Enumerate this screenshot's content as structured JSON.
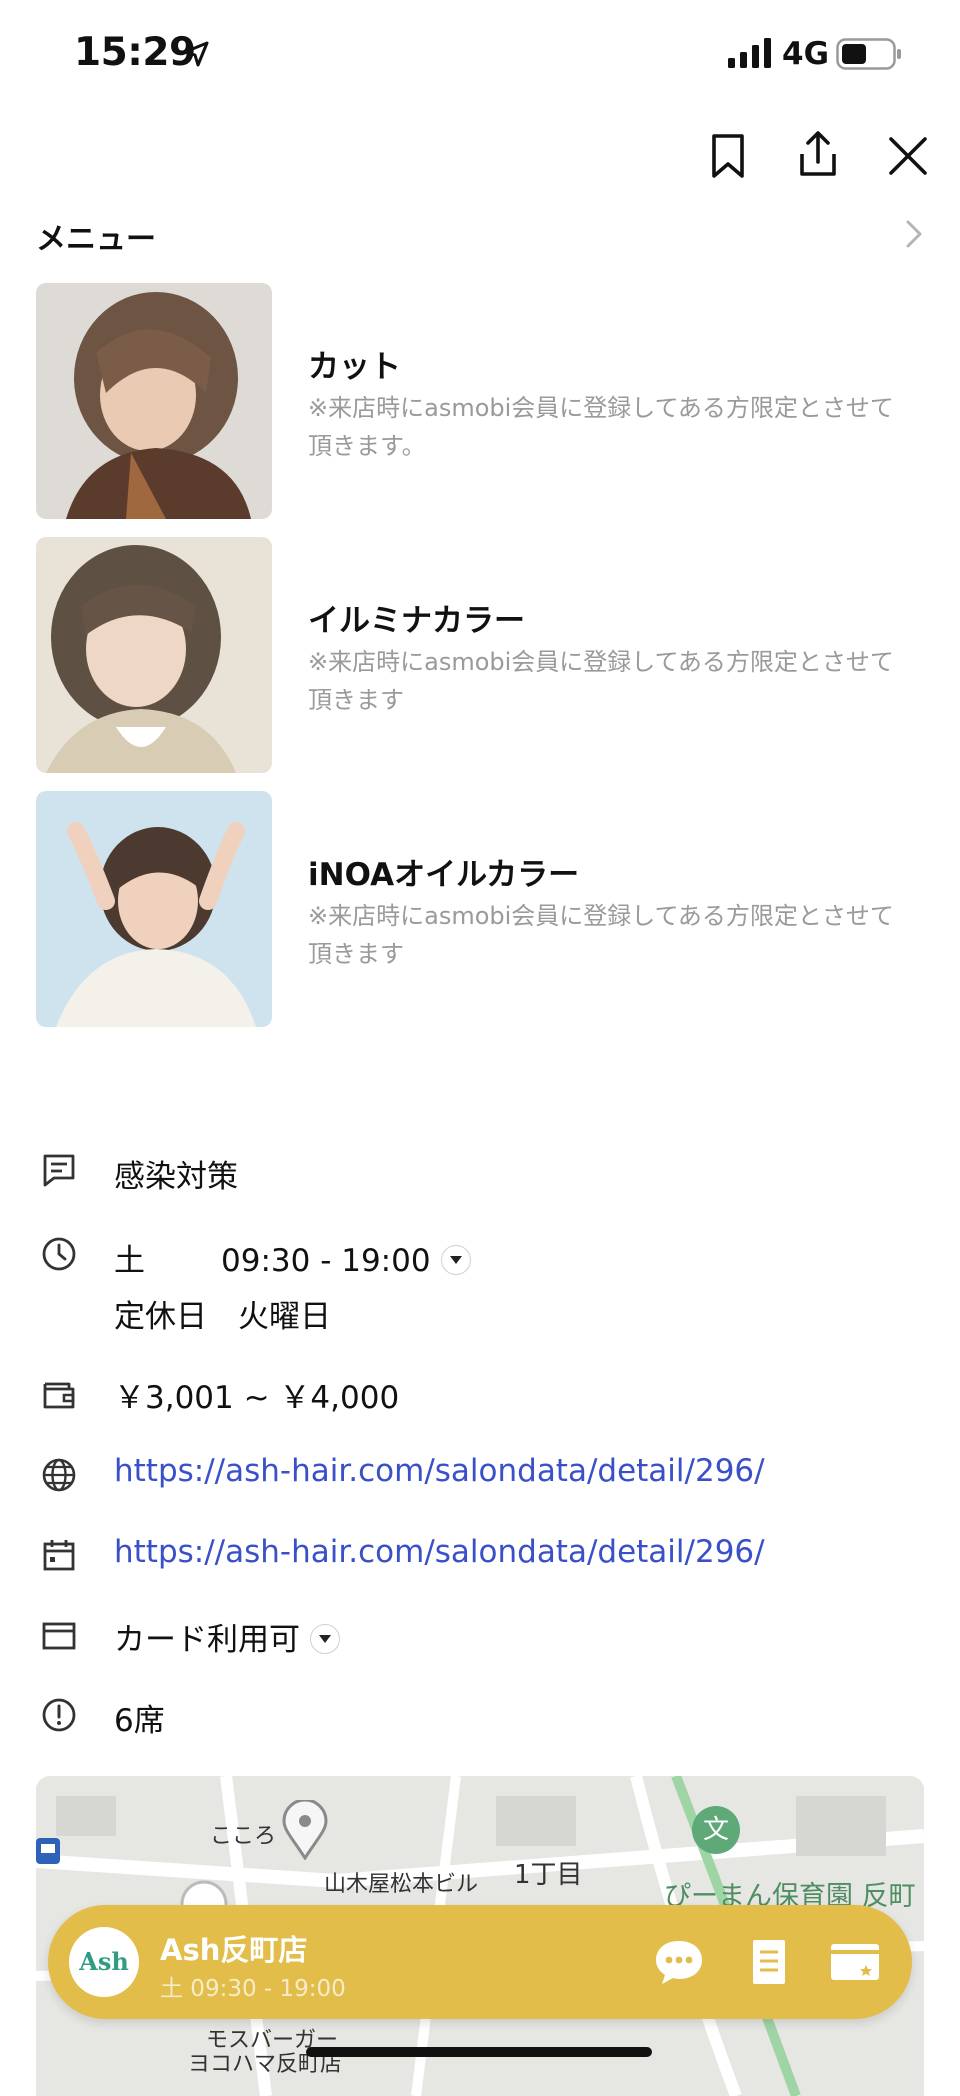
{
  "status_bar": {
    "time": "15:29",
    "network": "4G"
  },
  "menu": {
    "title": "メニュー",
    "items": [
      {
        "name": "カット",
        "description": "※来店時にasmobi会員に登録してある方限定とさせて頂きます。"
      },
      {
        "name": "イルミナカラー",
        "description": "※来店時にasmobi会員に登録してある方限定とさせて頂きます"
      },
      {
        "name": "iNOAオイルカラー",
        "description": "※来店時にasmobi会員に登録してある方限定とさせて頂きます"
      }
    ]
  },
  "info": {
    "infection_control": "感染対策",
    "hours_day": "土",
    "hours_time": "09:30 - 19:00",
    "closed_day": "定休日　火曜日",
    "price_range": "￥3,001 ~ ￥4,000",
    "website_url": "https://ash-hair.com/salondata/detail/296/",
    "reservation_url": "https://ash-hair.com/salondata/detail/296/",
    "payment": "カード利用可",
    "seats": "6席"
  },
  "map": {
    "labels": [
      "こころ",
      "山木屋松本ビル",
      "1丁目",
      "ぴーまん保育園 反町",
      "モスバーガー",
      "ヨコハマ反町店"
    ],
    "school_glyph": "文"
  },
  "shop_bar": {
    "logo_text": "Ash",
    "name": "Ash反町店",
    "hours": "土 09:30 - 19:00"
  },
  "colors": {
    "accent": "#e2bd4a",
    "link": "#3a50c9",
    "muted": "#9a9a9a"
  }
}
